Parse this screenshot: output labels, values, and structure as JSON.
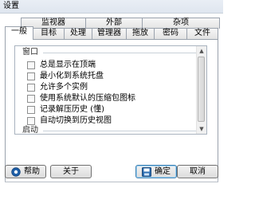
{
  "window": {
    "title": "设置"
  },
  "tabs_back_row": [
    {
      "label": "监视器"
    },
    {
      "label": "外部"
    },
    {
      "label": "杂项"
    }
  ],
  "tabs_front_row": [
    {
      "label": "一般",
      "active": true
    },
    {
      "label": "目标"
    },
    {
      "label": "处理"
    },
    {
      "label": "管理器"
    },
    {
      "label": "拖放"
    },
    {
      "label": "密码"
    },
    {
      "label": "文件"
    }
  ],
  "groups": [
    {
      "label": "窗口"
    },
    {
      "label": "启动"
    }
  ],
  "options": [
    {
      "label": "总是显示在顶端",
      "checked": false
    },
    {
      "label": "最小化到系统托盘",
      "checked": false
    },
    {
      "label": "允许多个实例",
      "checked": false
    },
    {
      "label": "使用系统默认的压缩包图标",
      "checked": false
    },
    {
      "label": "记录解压历史 (懂)",
      "checked": false
    },
    {
      "label": "自动切换到历史视图",
      "checked": false
    }
  ],
  "buttons": {
    "help": "帮助",
    "about": "关于",
    "ok": "确定",
    "cancel": "取消"
  },
  "colors": {
    "accent": "#3c7fb1",
    "help_icon": "#1f5fa8",
    "ok_icon": "#2e6fb2"
  }
}
